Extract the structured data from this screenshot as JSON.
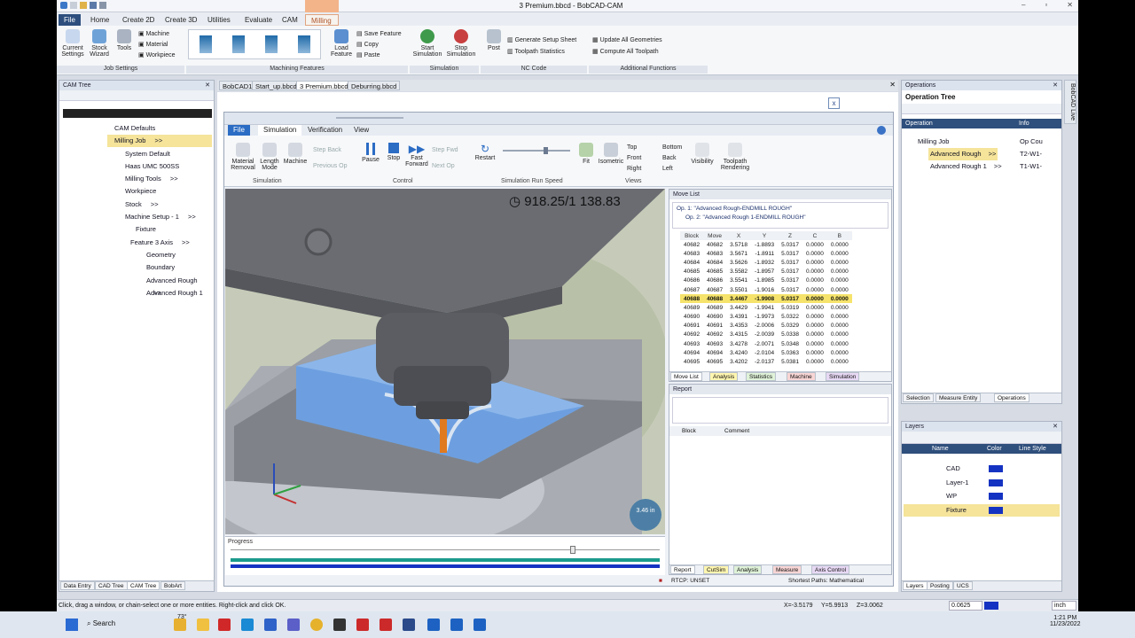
{
  "window": {
    "title": "3 Premium.bbcd - BobCAD-CAM"
  },
  "ribbon_tabs": [
    "File",
    "Home",
    "Create 2D",
    "Create 3D",
    "Utilities",
    "Evaluate",
    "CAM",
    "Milling"
  ],
  "milling_group_title": "Milling",
  "ribbon": {
    "job_settings": {
      "label": "Job Settings",
      "current": "Current Settings",
      "stock": "Stock Wizard",
      "tools": "Tools",
      "machine": "Machine",
      "material": "Material",
      "workpiece": "Workpiece"
    },
    "machining_features": {
      "label": "Machining Features",
      "load": "Load Feature",
      "save": "Save Feature",
      "copy": "Copy",
      "paste": "Paste"
    },
    "simulation": {
      "label": "Simulation",
      "start": "Start Simulation",
      "stop": "Stop Simulation"
    },
    "nc_code": {
      "label": "NC Code",
      "post": "Post",
      "gen_sheet": "Generate Setup Sheet",
      "toolpath_stats": "Toolpath Statistics"
    },
    "additional": {
      "label": "Additional Functions",
      "update": "Update All Geometries",
      "compute": "Compute All Toolpath"
    }
  },
  "cam_tree": {
    "title": "CAM Tree",
    "items": [
      "CAM Defaults",
      "Milling Job",
      ">>",
      "System Default",
      "Haas UMC 500SS",
      "Milling Tools",
      ">>",
      "Workpiece",
      "Stock",
      ">>",
      "Machine Setup - 1",
      ">>",
      "Fixture",
      "Feature 3 Axis",
      ">>",
      "Geometry",
      "Boundary",
      "Advanced Rough",
      ">>",
      "Advanced Rough 1"
    ],
    "bottom_tabs": [
      "Data Entry",
      "CAD Tree",
      "CAM Tree",
      "BobArt"
    ]
  },
  "doc_tabs": [
    "BobCAD1",
    "Start_up.bbcd",
    "3 Premium.bbcd",
    "Deburring.bbcd"
  ],
  "sim": {
    "tabs": [
      "File",
      "Simulation",
      "Verification",
      "View"
    ],
    "close": "x",
    "buttons": {
      "material_removal": "Material Removal",
      "length_mode": "Length Mode",
      "machine": "Machine",
      "step_back": "Step Back",
      "previous_op": "Previous Op",
      "pause": "Pause",
      "stop": "Stop",
      "fast_forward": "Fast Forward",
      "step_fwd": "Step Fwd",
      "next_op": "Next Op",
      "restart": "Restart",
      "fit": "Fit",
      "isometric": "Isometric",
      "top": "Top",
      "front": "Front",
      "right": "Right",
      "bottom": "Bottom",
      "back": "Back",
      "left": "Left",
      "visibility": "Visibility",
      "toolpath_rendering": "Toolpath Rendering"
    },
    "groups": {
      "simulation": "Simulation",
      "control": "Control",
      "run_speed": "Simulation Run Speed",
      "views": "Views"
    },
    "timer": "918.25/1 138.83",
    "gauge": "3.46 in",
    "progress_label": "Progress",
    "progress_value": 0.96,
    "rtcp": "RTCP: UNSET",
    "shortest": "Shortest Paths: Mathematical"
  },
  "move_list": {
    "title": "Move List",
    "ops": [
      "Op. 1: \"Advanced Rough-ENDMILL ROUGH\"",
      "Op. 2: \"Advanced Rough 1-ENDMILL ROUGH\""
    ],
    "columns": [
      "Block",
      "Move",
      "X",
      "Y",
      "Z",
      "C",
      "B"
    ],
    "rows": [
      [
        "40682",
        "40682",
        "3.5718",
        "-1.8893",
        "5.0317",
        "0.0000",
        "0.0000"
      ],
      [
        "40683",
        "40683",
        "3.5671",
        "-1.8911",
        "5.0317",
        "0.0000",
        "0.0000"
      ],
      [
        "40684",
        "40684",
        "3.5626",
        "-1.8932",
        "5.0317",
        "0.0000",
        "0.0000"
      ],
      [
        "40685",
        "40685",
        "3.5582",
        "-1.8957",
        "5.0317",
        "0.0000",
        "0.0000"
      ],
      [
        "40686",
        "40686",
        "3.5541",
        "-1.8985",
        "5.0317",
        "0.0000",
        "0.0000"
      ],
      [
        "40687",
        "40687",
        "3.5501",
        "-1.9016",
        "5.0317",
        "0.0000",
        "0.0000"
      ],
      [
        "40688",
        "40688",
        "3.4467",
        "-1.9908",
        "5.0317",
        "0.0000",
        "0.0000"
      ],
      [
        "40689",
        "40689",
        "3.4429",
        "-1.9941",
        "5.0319",
        "0.0000",
        "0.0000"
      ],
      [
        "40690",
        "40690",
        "3.4391",
        "-1.9973",
        "5.0322",
        "0.0000",
        "0.0000"
      ],
      [
        "40691",
        "40691",
        "3.4353",
        "-2.0006",
        "5.0329",
        "0.0000",
        "0.0000"
      ],
      [
        "40692",
        "40692",
        "3.4315",
        "-2.0039",
        "5.0338",
        "0.0000",
        "0.0000"
      ],
      [
        "40693",
        "40693",
        "3.4278",
        "-2.0071",
        "5.0348",
        "0.0000",
        "0.0000"
      ],
      [
        "40694",
        "40694",
        "3.4240",
        "-2.0104",
        "5.0363",
        "0.0000",
        "0.0000"
      ],
      [
        "40695",
        "40695",
        "3.4202",
        "-2.0137",
        "5.0381",
        "0.0000",
        "0.0000"
      ]
    ],
    "highlight_index": 6,
    "tabs": [
      "Move List",
      "Analysis",
      "Statistics",
      "Machine",
      "Simulation"
    ]
  },
  "report": {
    "title": "Report",
    "cols": [
      "Block",
      "Comment"
    ],
    "tabs": [
      "Report",
      "CutSim",
      "Analysis",
      "Measure",
      "Axis Control"
    ]
  },
  "operations": {
    "title": "Operations",
    "tree_title": "Operation Tree",
    "cols": [
      "Operation",
      "Info"
    ],
    "items": [
      {
        "name": "Milling Job",
        "info": "Op Cou"
      },
      {
        "name": "Advanced Rough",
        ">>": ">>",
        "info": "T2-W1-"
      },
      {
        "name": "Advanced Rough 1",
        ">>": ">>",
        "info": "T1-W1-"
      }
    ],
    "tabs": [
      "Selection",
      "Measure Entity",
      "Operations"
    ],
    "side_tab": "BobCAD Live"
  },
  "layers": {
    "title": "Layers",
    "cols": [
      "Name",
      "Color",
      "Line Style"
    ],
    "rows": [
      "CAD",
      "Layer-1",
      "WP",
      "Fixture"
    ],
    "tabs": [
      "Layers",
      "Posting",
      "UCS"
    ]
  },
  "status": {
    "hint": "Click, drag a window, or chain-select one or more entities. Right-click and click OK.",
    "x": "X=-3.5179",
    "y": "Y=5.9913",
    "z": "Z=3.0062",
    "value": "0.0625",
    "unit": "inch"
  },
  "taskbar": {
    "search": "Search",
    "temp": "73°",
    "time": "1:21 PM",
    "date": "11/23/2022"
  },
  "colors": {
    "accent": "#2b6cc4",
    "highlight_row": "#f5e36b",
    "workpiece": "#7faee8",
    "progress_teal": "#1c9b8c",
    "progress_blue": "#1533c2"
  }
}
